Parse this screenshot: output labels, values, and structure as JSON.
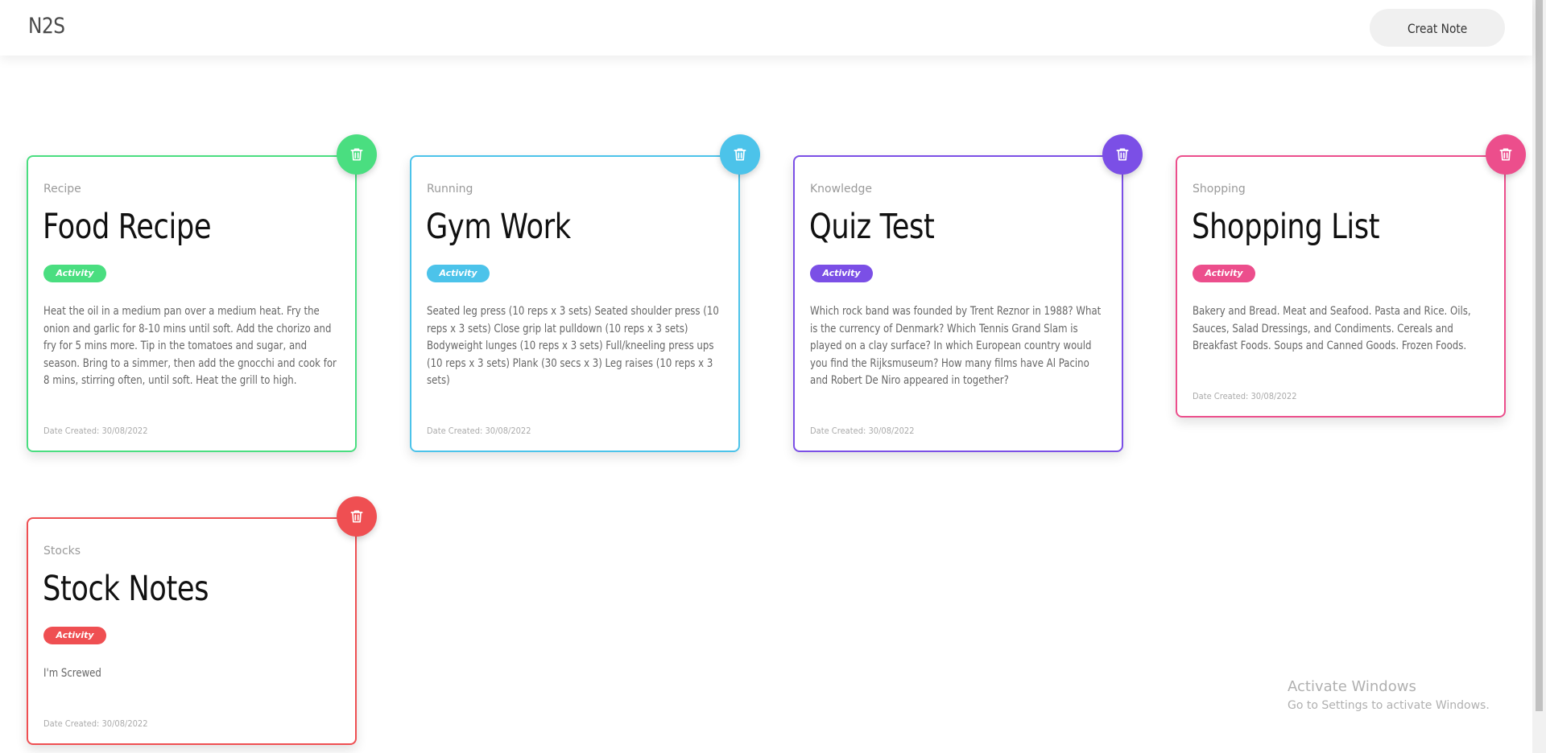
{
  "app": {
    "brand": "N2S",
    "create_label": "Creat Note"
  },
  "notes": [
    {
      "category": "Recipe",
      "title": "Food Recipe",
      "badge": "Activity",
      "body": "Heat the oil in a medium pan over a medium heat. Fry the onion and garlic for 8-10 mins until soft. Add the chorizo and fry for 5 mins more. Tip in the tomatoes and sugar, and season. Bring to a simmer, then add the gnocchi and cook for 8 mins, stirring often, until soft. Heat the grill to high.",
      "date": "Date Created: 30/08/2022",
      "color": "#4ade80"
    },
    {
      "category": "Running",
      "title": "Gym Work",
      "badge": "Activity",
      "body": "Seated leg press (10 reps x 3 sets) Seated shoulder press (10 reps x 3 sets) Close grip lat pulldown (10 reps x 3 sets) Bodyweight lunges (10 reps x 3 sets) Full/kneeling press ups (10 reps x 3 sets) Plank (30 secs x 3) Leg raises (10 reps x 3 sets)",
      "date": "Date Created: 30/08/2022",
      "color": "#4cc3ea"
    },
    {
      "category": "Knowledge",
      "title": "Quiz Test",
      "badge": "Activity",
      "body": "Which rock band was founded by Trent Reznor in 1988? What is the currency of Denmark? Which Tennis Grand Slam is played on a clay surface? In which European country would you find the Rijksmuseum? How many films have Al Pacino and Robert De Niro appeared in together?",
      "date": "Date Created: 30/08/2022",
      "color": "#7b4fe6"
    },
    {
      "category": "Shopping",
      "title": "Shopping List",
      "badge": "Activity",
      "body": "Bakery and Bread. Meat and Seafood. Pasta and Rice. Oils, Sauces, Salad Dressings, and Condiments. Cereals and Breakfast Foods. Soups and Canned Goods. Frozen Foods.",
      "date": "Date Created: 30/08/2022",
      "color": "#ec4e8c"
    },
    {
      "category": "Stocks",
      "title": "Stock Notes",
      "badge": "Activity",
      "body": "I'm Screwed",
      "date": "Date Created: 30/08/2022",
      "color": "#ef4f52"
    }
  ],
  "watermark": {
    "line1": "Activate Windows",
    "line2": "Go to Settings to activate Windows."
  }
}
